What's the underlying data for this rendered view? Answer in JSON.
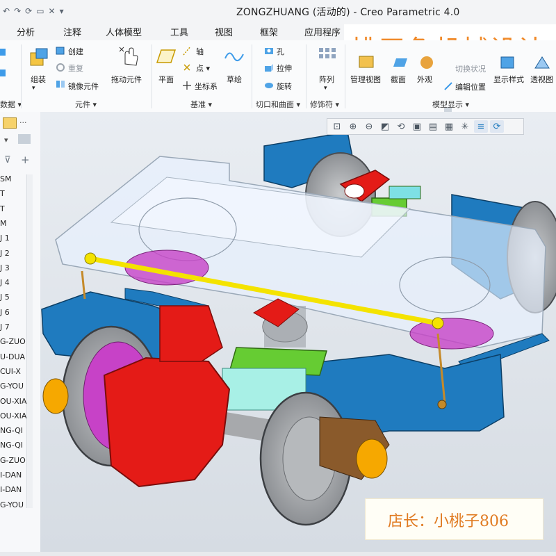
{
  "window": {
    "title": "ZONGZHUANG (活动的) - Creo Parametric 4.0"
  },
  "tabs": [
    {
      "label": "分析"
    },
    {
      "label": "注释"
    },
    {
      "label": "人体模型"
    },
    {
      "label": "工具"
    },
    {
      "label": "视图"
    },
    {
      "label": "框架"
    },
    {
      "label": "应用程序"
    }
  ],
  "ribbon": {
    "groups": {
      "data": "数据",
      "components": "元件",
      "datum": "基准",
      "cut_surface": "切口和曲面",
      "modifiers": "修饰符",
      "model_display": "模型显示"
    },
    "buttons": {
      "assemble": "组装",
      "create": "创建",
      "repeat": "重复",
      "mirror_component": "镜像元件",
      "drag_components": "拖动元件",
      "plane": "平面",
      "axis": "轴",
      "point": "点",
      "csys": "坐标系",
      "sketch": "草绘",
      "hole": "孔",
      "extrude": "拉伸",
      "revolve": "旋转",
      "pattern": "阵列",
      "manage_views": "管理视图",
      "section": "截面",
      "appearance": "外观",
      "switch_state": "切换状况",
      "edit_position": "编辑位置",
      "display_style": "显示样式",
      "perspective": "透视图"
    }
  },
  "watermark": {
    "text": "桃天兔机械设计"
  },
  "shop_label": {
    "text": "店长：小桃子806"
  },
  "model_tree": {
    "items": [
      "SM",
      "T",
      "T",
      "M",
      "J 1",
      "J 2",
      "J 3",
      "J 4",
      "J 5",
      "J 6",
      "J 7",
      "G-ZUO",
      "U-DUA",
      "CUI-X",
      "G-YOU",
      "OU-XIA",
      "OU-XIA",
      "NG-QI",
      "NG-QI",
      "G-ZUO",
      "I-DAN",
      "I-DAN",
      "G-YOU"
    ]
  },
  "colors": {
    "accent_watermark": "#f08a2a",
    "frame_blue": "#1f7bbf",
    "brake_red": "#e41b17",
    "rod_yellow": "#f4e300",
    "wheel_gray": "#a7a9ac",
    "bearing_orange": "#f6a800",
    "support_green": "#66cc33",
    "magenta": "#c742c7",
    "translucent": "#e8f1ff"
  },
  "icons": {
    "graphics_toolbar": [
      "refit-icon",
      "zoom-in-icon",
      "zoom-out-icon",
      "repaint-icon",
      "spin-center-icon",
      "saved-orientations-icon",
      "view-manager-icon",
      "display-style-icon",
      "datum-display-icon",
      "annotation-display-icon",
      "spin-icon"
    ]
  }
}
